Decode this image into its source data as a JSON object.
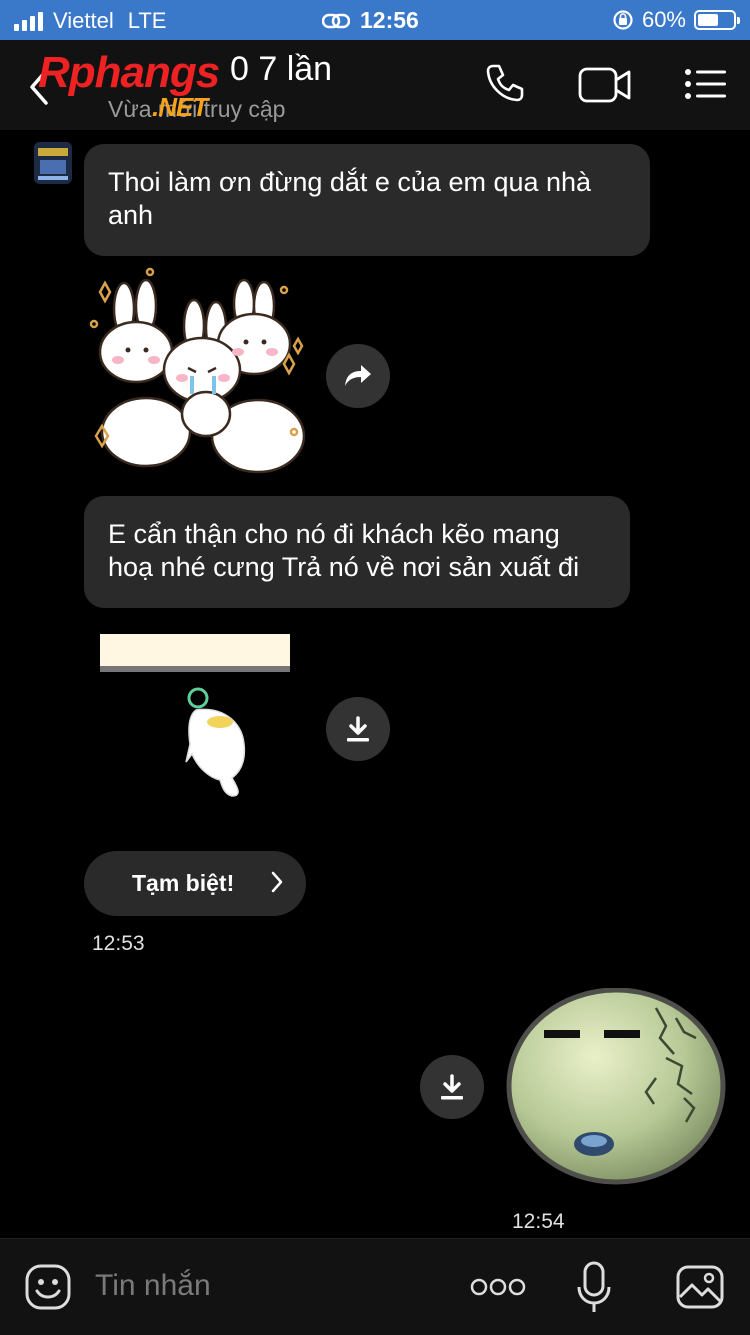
{
  "status_bar": {
    "carrier": "Viettel",
    "network": "LTE",
    "time": "12:56",
    "battery": "60%",
    "battery_level": 0.6
  },
  "header": {
    "title": "0 7 lần",
    "subtitle": "Vừa mới truy cập",
    "watermark_main": "Rphangs",
    "watermark_sub": ".NET"
  },
  "messages": {
    "msg1": "Thoi làm ơn đừng dắt e của em qua nhà anh",
    "msg2": "E cẩn thận cho nó đi khách kẽo mang hoạ nhé cưng Trả nó về nơi sản xuất đi",
    "quick_reply": "Tạm biệt!",
    "time_received": "12:53",
    "time_sent": "12:54"
  },
  "composer": {
    "placeholder": "Tin nhắn"
  }
}
